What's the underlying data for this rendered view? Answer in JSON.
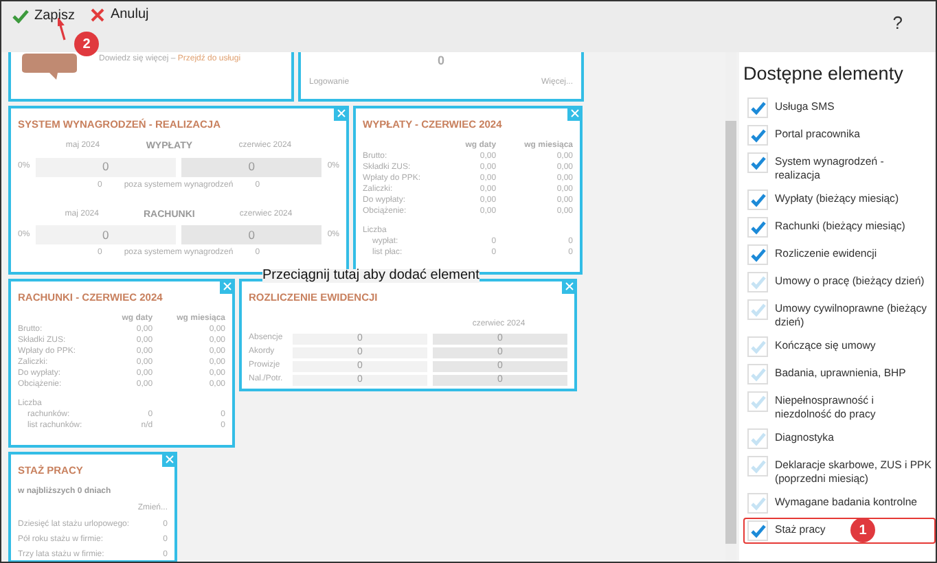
{
  "toolbar": {
    "buttons": [
      {
        "kind": "save",
        "label": "Zapisz"
      },
      {
        "kind": "cancel",
        "label": "Anuluj"
      }
    ],
    "help": "?"
  },
  "widgets": [
    {
      "kind": "promo",
      "lead": "Dowiedz się więcej –",
      "link": "Przejdź do usługi"
    },
    {
      "kind": "counter",
      "value": "0",
      "label": "Logowanie",
      "more": "Więcej..."
    },
    {
      "kind": "realization",
      "title": "SYSTEM WYNAGRODZEŃ - REALIZACJA",
      "sections": [
        {
          "heading": "WYPŁATY",
          "month_prev": "maj 2024",
          "month_cur": "czerwiec 2024",
          "pct_prev": "0%",
          "value_prev": "0",
          "value_cur": "0",
          "pct_cur": "0%",
          "outside_prev": "0",
          "outside_label": "poza systemem wynagrodzeń",
          "outside_cur": "0"
        },
        {
          "heading": "RACHUNKI",
          "month_prev": "maj 2024",
          "month_cur": "czerwiec 2024",
          "pct_prev": "0%",
          "value_prev": "0",
          "value_cur": "0",
          "pct_cur": "0%",
          "outside_prev": "0",
          "outside_label": "poza systemem wynagrodzeń",
          "outside_cur": "0"
        }
      ]
    },
    {
      "kind": "summary",
      "title": "WYPŁATY - CZERWIEC 2024",
      "columns": [
        "wg daty",
        "wg miesiąca"
      ],
      "rows": [
        {
          "label": "Brutto:",
          "values": [
            "0,00",
            "0,00"
          ]
        },
        {
          "label": "Składki ZUS:",
          "values": [
            "0,00",
            "0,00"
          ]
        },
        {
          "label": "Wpłaty do PPK:",
          "values": [
            "0,00",
            "0,00"
          ]
        },
        {
          "label": "Zaliczki:",
          "values": [
            "0,00",
            "0,00"
          ]
        },
        {
          "label": "Do wypłaty:",
          "values": [
            "0,00",
            "0,00"
          ]
        },
        {
          "label": "Obciążenie:",
          "values": [
            "0,00",
            "0,00"
          ]
        }
      ],
      "count_label": "Liczba",
      "count_rows": [
        {
          "label": "wypłat:",
          "values": [
            "0",
            "0"
          ]
        },
        {
          "label": "list płac:",
          "values": [
            "0",
            "0"
          ]
        }
      ]
    },
    {
      "kind": "summary",
      "title": "RACHUNKI - CZERWIEC 2024",
      "columns": [
        "wg daty",
        "wg miesiąca"
      ],
      "rows": [
        {
          "label": "Brutto:",
          "values": [
            "0,00",
            "0,00"
          ]
        },
        {
          "label": "Składki ZUS:",
          "values": [
            "0,00",
            "0,00"
          ]
        },
        {
          "label": "Wpłaty do PPK:",
          "values": [
            "0,00",
            "0,00"
          ]
        },
        {
          "label": "Zaliczki:",
          "values": [
            "0,00",
            "0,00"
          ]
        },
        {
          "label": "Do wypłaty:",
          "values": [
            "0,00",
            "0,00"
          ]
        },
        {
          "label": "Obciążenie:",
          "values": [
            "0,00",
            "0,00"
          ]
        }
      ],
      "count_label": "Liczba",
      "count_rows": [
        {
          "label": "rachunków:",
          "values": [
            "0",
            "0"
          ]
        },
        {
          "label": "list rachunków:",
          "values": [
            "n/d",
            "0"
          ]
        }
      ]
    },
    {
      "kind": "records",
      "title": "ROZLICZENIE EWIDENCJI",
      "column": "czerwiec 2024",
      "rows": [
        {
          "label": "Absencje",
          "values": [
            "0",
            "0"
          ]
        },
        {
          "label": "Akordy",
          "values": [
            "0",
            "0"
          ]
        },
        {
          "label": "Prowizje",
          "values": [
            "0",
            "0"
          ]
        },
        {
          "label": "Nal./Potr.",
          "values": [
            "0",
            "0"
          ]
        }
      ]
    },
    {
      "kind": "seniority",
      "title": "STAŻ PRACY",
      "subtitle": "w najbliższych 0 dniach",
      "link": "Zmień...",
      "rows": [
        {
          "label": "Dziesięć lat stażu urlopowego:",
          "value": "0"
        },
        {
          "label": "Pół roku stażu w firmie:",
          "value": "0"
        },
        {
          "label": "Trzy lata stażu w firmie:",
          "value": "0"
        }
      ]
    }
  ],
  "drop_hint": "Przeciągnij tutaj aby dodać element",
  "panel": {
    "title": "Dostępne elementy",
    "items": [
      {
        "label": "Usługa SMS",
        "checked": true,
        "highlighted": false
      },
      {
        "label": "Portal pracownika",
        "checked": true,
        "highlighted": false
      },
      {
        "label": "System wynagrodzeń - realizacja",
        "checked": true,
        "highlighted": false
      },
      {
        "label": "Wypłaty (bieżący miesiąc)",
        "checked": true,
        "highlighted": false
      },
      {
        "label": "Rachunki (bieżący miesiąc)",
        "checked": true,
        "highlighted": false
      },
      {
        "label": "Rozliczenie ewidencji",
        "checked": true,
        "highlighted": false
      },
      {
        "label": "Umowy o pracę (bieżący dzień)",
        "checked": false,
        "highlighted": false
      },
      {
        "label": "Umowy cywilnoprawne (bieżący dzień)",
        "checked": false,
        "highlighted": false
      },
      {
        "label": "Kończące się umowy",
        "checked": false,
        "highlighted": false
      },
      {
        "label": "Badania, uprawnienia, BHP",
        "checked": false,
        "highlighted": false
      },
      {
        "label": "Niepełnosprawność i niezdolność do pracy",
        "checked": false,
        "highlighted": false
      },
      {
        "label": "Diagnostyka",
        "checked": false,
        "highlighted": false
      },
      {
        "label": "Deklaracje skarbowe, ZUS i PPK (poprzedni miesiąc)",
        "checked": false,
        "highlighted": false
      },
      {
        "label": "Wymagane badania kontrolne",
        "checked": false,
        "highlighted": false
      },
      {
        "label": "Staż pracy",
        "checked": true,
        "highlighted": true
      }
    ]
  },
  "annotations": [
    {
      "number": "2"
    },
    {
      "number": "1"
    }
  ]
}
